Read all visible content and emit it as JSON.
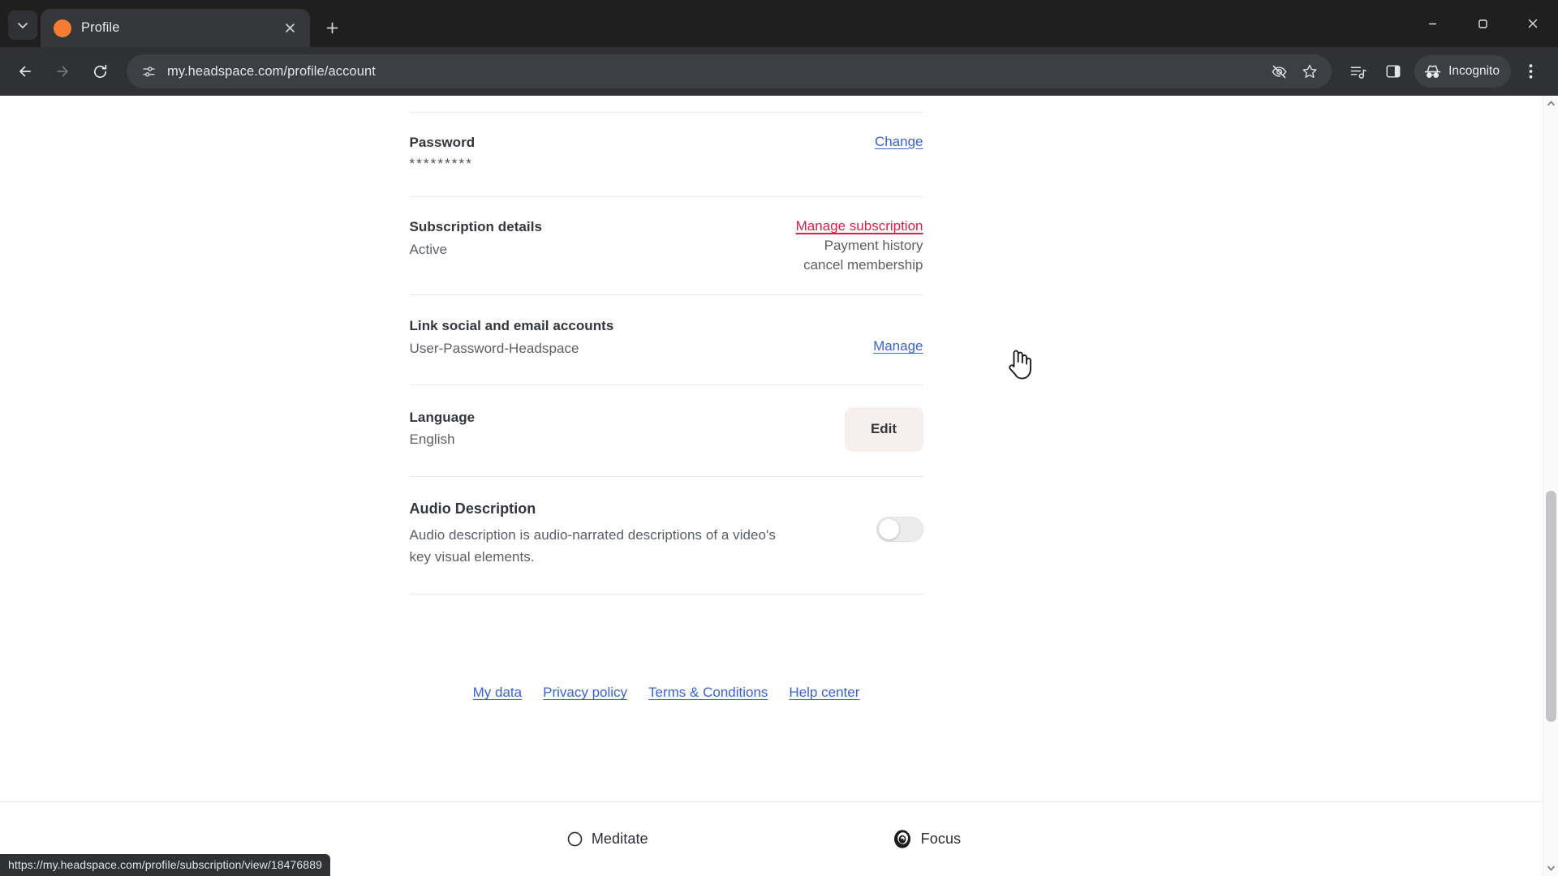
{
  "browser": {
    "tab": {
      "title": "Profile",
      "favicon": "headspace-orange-dot"
    },
    "tab_list_icon": "chevron-down-icon",
    "new_tab_icon": "plus-icon",
    "window_controls": {
      "minimize": "minimize-icon",
      "maximize": "maximize-icon",
      "close": "close-icon"
    },
    "nav": {
      "back": "back-arrow-icon",
      "forward": "forward-arrow-icon",
      "reload": "reload-icon"
    },
    "omnibox": {
      "url": "my.headspace.com/profile/account",
      "site_info_icon": "page-settings-icon",
      "hide_password_icon": "eye-slash-icon",
      "bookmark_icon": "star-icon"
    },
    "toolbar": {
      "media_icon": "media-playlist-icon",
      "side_panel_icon": "side-panel-icon",
      "incognito_icon": "incognito-hat-icon",
      "incognito_label": "Incognito",
      "menu_icon": "three-dot-menu-icon"
    },
    "status_url": "https://my.headspace.com/profile/subscription/view/18476889"
  },
  "page": {
    "rows": {
      "password": {
        "title": "Password",
        "value": "*********",
        "action": "Change"
      },
      "subscription": {
        "title": "Subscription details",
        "value": "Active",
        "links": [
          {
            "label": "Manage subscription",
            "style": "red-hovered"
          },
          {
            "label": "Payment history",
            "style": "muted"
          },
          {
            "label": "cancel membership",
            "style": "muted"
          }
        ]
      },
      "social": {
        "title": "Link social and email accounts",
        "value": "User-Password-Headspace",
        "action": "Manage"
      },
      "language": {
        "title": "Language",
        "value": "English",
        "action": "Edit"
      },
      "audio_description": {
        "title": "Audio Description",
        "description": "Audio description is audio-narrated descriptions of a video's key visual elements.",
        "toggle_state": "off"
      }
    },
    "footer_links": [
      "My data",
      "Privacy policy",
      "Terms & Conditions",
      "Help center"
    ],
    "bottom_nav": [
      {
        "label": "Meditate",
        "icon": "circle-outline-icon"
      },
      {
        "label": "Focus",
        "icon": "concentric-spiral-icon"
      }
    ]
  },
  "colors": {
    "link_blue": "#3b63c9",
    "link_red": "#d6224a",
    "edit_button_bg": "#f7efed",
    "favicon_orange": "#f47d31",
    "chrome_dark": "#2f3134"
  }
}
